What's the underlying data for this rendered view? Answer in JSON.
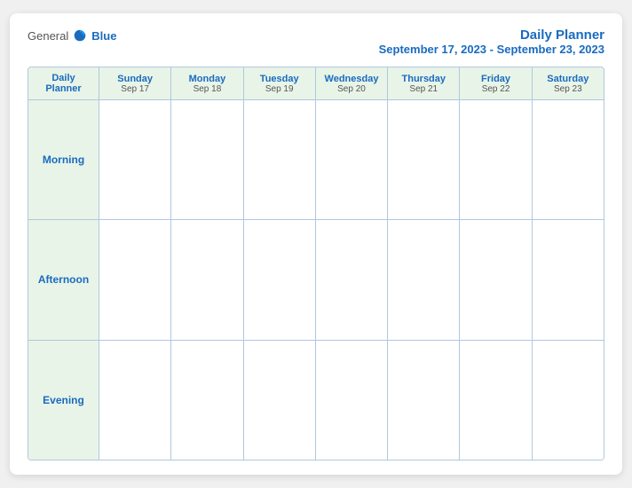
{
  "header": {
    "logo": {
      "general": "General",
      "blue": "Blue",
      "bird_symbol": "▶"
    },
    "title": "Daily Planner",
    "subtitle": "September 17, 2023 - September 23, 2023"
  },
  "calendar": {
    "columns": [
      {
        "label": "Daily\nPlanner",
        "date": ""
      },
      {
        "label": "Sunday",
        "date": "Sep 17"
      },
      {
        "label": "Monday",
        "date": "Sep 18"
      },
      {
        "label": "Tuesday",
        "date": "Sep 19"
      },
      {
        "label": "Wednesday",
        "date": "Sep 20"
      },
      {
        "label": "Thursday",
        "date": "Sep 21"
      },
      {
        "label": "Friday",
        "date": "Sep 22"
      },
      {
        "label": "Saturday",
        "date": "Sep 23"
      }
    ],
    "rows": [
      {
        "label": "Morning"
      },
      {
        "label": "Afternoon"
      },
      {
        "label": "Evening"
      }
    ]
  }
}
